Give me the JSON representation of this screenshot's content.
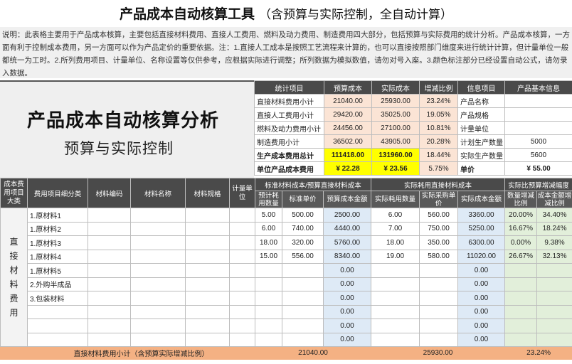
{
  "title": {
    "main": "产品成本自动核算工具",
    "sub": "（含预算与实际控制，全自动计算）"
  },
  "description": "说明：此表格主要用于产品成本核算，主要包括直接材料费用、直接人工费用、燃料及动力费用、制造费用四大部分，包括预算与实际费用的统计分析。产品成本核算，一方面有利于控制成本费用，另一方面可以作为产品定价的重要依据。注：1.直接人工成本是按照工艺流程来计算的，也可以直接按照部门维度来进行统计计算，但计量单位一般都统一为工时。2.所列费用项目、计量单位、名称设置等仅供参考，应根据实际进行调整；所列数据为模拟数值，请勿对号入座。3.颜色标注部分已经设置自动公式，请勿录入数据。",
  "banner": {
    "title": "产品成本自动核算分析",
    "subtitle": "预算与实际控制"
  },
  "stats": {
    "headers": [
      "统计项目",
      "预算成本",
      "实际成本",
      "增减比例",
      "信息项目",
      "产品基本信息"
    ],
    "rows": [
      {
        "item": "直接材料费用小计",
        "budget": "21040.00",
        "actual": "25930.00",
        "ratio": "23.24%",
        "info": "产品名称",
        "value": ""
      },
      {
        "item": "直接人工费用小计",
        "budget": "29420.00",
        "actual": "35025.00",
        "ratio": "19.05%",
        "info": "产品规格",
        "value": ""
      },
      {
        "item": "燃料及动力费用小计",
        "budget": "24456.00",
        "actual": "27100.00",
        "ratio": "10.81%",
        "info": "计量单位",
        "value": ""
      },
      {
        "item": "制造费用小计",
        "budget": "36502.00",
        "actual": "43905.00",
        "ratio": "20.28%",
        "info": "计划生产数量",
        "value": "5000"
      },
      {
        "item": "生产成本费用总计",
        "budget": "111418.00",
        "actual": "131960.00",
        "ratio": "18.44%",
        "info": "实际生产数量",
        "value": "5600"
      },
      {
        "item": "单位产品成本费用",
        "budget": "¥ 22.28",
        "actual": "¥ 23.56",
        "ratio": "5.75%",
        "info": "单价",
        "value": "¥ 55.00"
      }
    ]
  },
  "detail": {
    "group_headers": {
      "category": "成本费用项目大类",
      "sub_category": "费用项目细分类",
      "material_code": "材料编码",
      "material_name": "材料名称",
      "material_spec": "材料规格",
      "unit": "计量单位",
      "budget_group": "标准材料成本/预算直接材料成本",
      "actual_group": "实际耗用直接材料成本",
      "compare_group": "实际比预算增减幅度"
    },
    "sub_headers": {
      "budget_qty": "预计耗用数量",
      "std_price": "标准单价",
      "budget_cost": "预算成本金额",
      "actual_qty": "实际耗用数量",
      "actual_price": "实际采购单价",
      "actual_cost": "实际成本金额",
      "qty_change": "数量增减比例",
      "cost_change": "成本金额增减比例"
    },
    "category_label": "直接材料费用",
    "rows": [
      {
        "name": "1.原材料1",
        "bq": "5.00",
        "sp": "500.00",
        "bc": "2500.00",
        "aq": "6.00",
        "ap": "560.00",
        "ac": "3360.00",
        "qc": "20.00%",
        "cc": "34.40%"
      },
      {
        "name": "1.原材料2",
        "bq": "6.00",
        "sp": "740.00",
        "bc": "4440.00",
        "aq": "7.00",
        "ap": "750.00",
        "ac": "5250.00",
        "qc": "16.67%",
        "cc": "18.24%"
      },
      {
        "name": "1.原材料3",
        "bq": "18.00",
        "sp": "320.00",
        "bc": "5760.00",
        "aq": "18.00",
        "ap": "350.00",
        "ac": "6300.00",
        "qc": "0.00%",
        "cc": "9.38%"
      },
      {
        "name": "1.原材料4",
        "bq": "15.00",
        "sp": "556.00",
        "bc": "8340.00",
        "aq": "19.00",
        "ap": "580.00",
        "ac": "11020.00",
        "qc": "26.67%",
        "cc": "32.13%"
      },
      {
        "name": "1.原材料5",
        "bq": "",
        "sp": "",
        "bc": "0.00",
        "aq": "",
        "ap": "",
        "ac": "0.00",
        "qc": "",
        "cc": ""
      },
      {
        "name": "2.外购半成品",
        "bq": "",
        "sp": "",
        "bc": "0.00",
        "aq": "",
        "ap": "",
        "ac": "0.00",
        "qc": "",
        "cc": ""
      },
      {
        "name": "3.包装材料",
        "bq": "",
        "sp": "",
        "bc": "0.00",
        "aq": "",
        "ap": "",
        "ac": "0.00",
        "qc": "",
        "cc": ""
      },
      {
        "name": "",
        "bq": "",
        "sp": "",
        "bc": "0.00",
        "aq": "",
        "ap": "",
        "ac": "0.00",
        "qc": "",
        "cc": ""
      },
      {
        "name": "",
        "bq": "",
        "sp": "",
        "bc": "0.00",
        "aq": "",
        "ap": "",
        "ac": "0.00",
        "qc": "",
        "cc": ""
      },
      {
        "name": "",
        "bq": "",
        "sp": "",
        "bc": "0.00",
        "aq": "",
        "ap": "",
        "ac": "0.00",
        "qc": "",
        "cc": ""
      }
    ],
    "footer": {
      "label": "直接材料费用小计（含预算实际增减比例）",
      "budget": "21040.00",
      "actual": "25930.00",
      "ratio": "23.24%"
    }
  },
  "colors": {
    "header_dark": "#4a4a4a",
    "highlight_yellow": "#ffff00",
    "formula_pink": "#fbe4d5",
    "formula_blue": "#deeaf6",
    "footer_orange": "#f4b183"
  }
}
